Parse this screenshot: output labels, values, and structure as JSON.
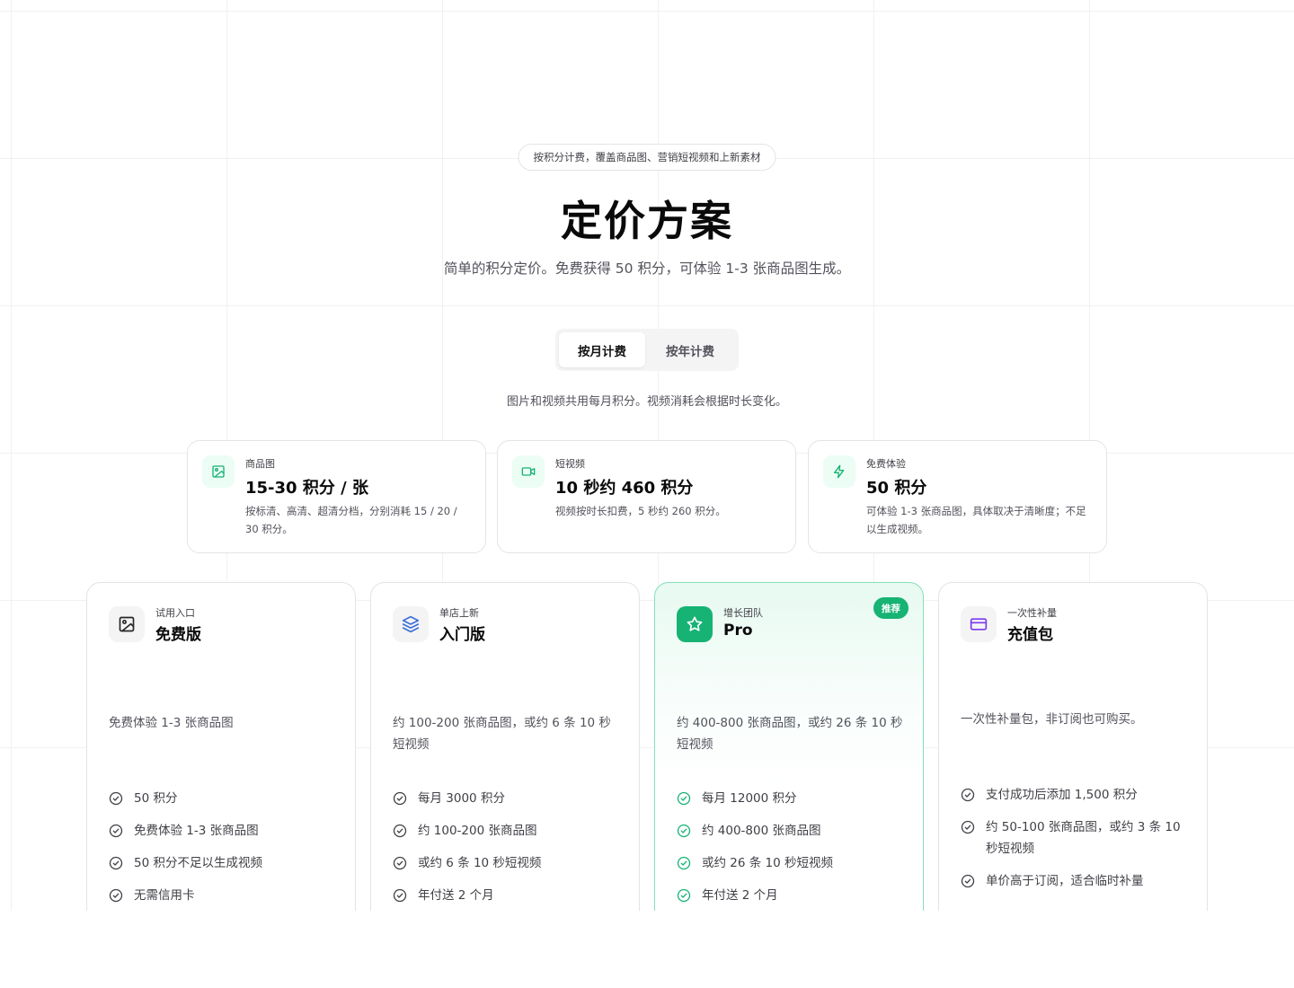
{
  "header": {
    "pill": "按积分计费，覆盖商品图、营销短视频和上新素材",
    "title": "定价方案",
    "subtitle": "简单的积分定价。免费获得 50 积分，可体验 1-3 张商品图生成。"
  },
  "billing_toggle": {
    "monthly": "按月计费",
    "yearly": "按年计费",
    "selected": "monthly"
  },
  "note": "图片和视频共用每月积分。视频消耗会根据时长变化。",
  "info_cards": [
    {
      "icon": "image-icon",
      "label": "商品图",
      "value": "15-30 积分 / 张",
      "desc": "按标清、高清、超清分档，分别消耗 15 / 20 / 30 积分。"
    },
    {
      "icon": "video-icon",
      "label": "短视频",
      "value": "10 秒约 460 积分",
      "desc": "视频按时长扣费，5 秒约 260 积分。"
    },
    {
      "icon": "lightning-icon",
      "label": "免费体验",
      "value": "50 积分",
      "desc": "可体验 1-3 张商品图，具体取决于清晰度；不足以生成视频。"
    }
  ],
  "plans": [
    {
      "icon": "image-icon",
      "tag": "试用入口",
      "name": "免费版",
      "desc": "免费体验 1-3 张商品图",
      "features": [
        "50 积分",
        "免费体验 1-3 张商品图",
        "50 积分不足以生成视频",
        "无需信用卡"
      ]
    },
    {
      "icon": "layers-icon",
      "tag": "单店上新",
      "name": "入门版",
      "desc": "约 100-200 张商品图，或约 6 条 10 秒短视频",
      "features": [
        "每月 3000 积分",
        "约 100-200 张商品图",
        "或约 6 条 10 秒短视频",
        "年付送 2 个月"
      ]
    },
    {
      "icon": "star-icon",
      "tag": "增长团队",
      "name": "Pro",
      "badge": "推荐",
      "desc": "约 400-800 张商品图，或约 26 条 10 秒短视频",
      "features": [
        "每月 12000 积分",
        "约 400-800 张商品图",
        "或约 26 条 10 秒短视频",
        "年付送 2 个月"
      ]
    },
    {
      "icon": "credit-card-icon",
      "tag": "一次性补量",
      "name": "充值包",
      "desc": "一次性补量包，非订阅也可购买。",
      "features": [
        "支付成功后添加 1,500 积分",
        "约 50-100 张商品图，或约 3 条 10 秒短视频",
        "单价高于订阅，适合临时补量"
      ]
    }
  ],
  "colors": {
    "accent": "#16b374",
    "accent_soft": "#ecfdf5",
    "border": "#e4e4e7",
    "text_muted": "#52525b",
    "starter_icon": "#3b6fd8",
    "topup_icon": "#7c3aed"
  }
}
